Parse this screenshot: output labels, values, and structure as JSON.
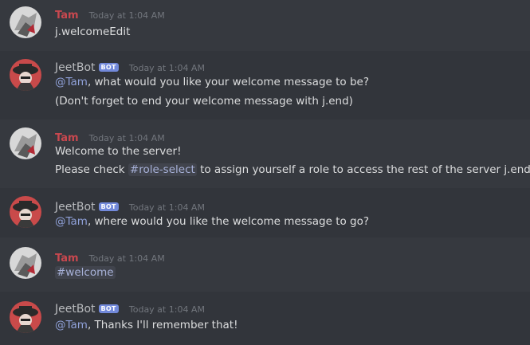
{
  "messages": [
    {
      "author": "Tam",
      "timestamp": "Today at 1:04 AM",
      "lines": [
        "j.welcomeEdit"
      ]
    },
    {
      "author": "JeetBot",
      "badge": "BOT",
      "timestamp": "Today at 1:04 AM",
      "mention": "@Tam",
      "line1_rest": ", what would you like your welcome message to be?",
      "line2": "(Don't forget to end your welcome message with j.end)"
    },
    {
      "author": "Tam",
      "timestamp": "Today at 1:04 AM",
      "line1": "Welcome to the server!",
      "line2_pre": "Please check ",
      "channel": "#role-select",
      "line2_post": " to assign yourself a role to access the rest of the server j.end"
    },
    {
      "author": "JeetBot",
      "badge": "BOT",
      "timestamp": "Today at 1:04 AM",
      "mention": "@Tam",
      "line1_rest": ", where would you like the welcome message to go?"
    },
    {
      "author": "Tam",
      "timestamp": "Today at 1:04 AM",
      "channel": "#welcome"
    },
    {
      "author": "JeetBot",
      "badge": "BOT",
      "timestamp": "Today at 1:04 AM",
      "mention": "@Tam",
      "line1_rest": ", Thanks I'll remember that!"
    }
  ],
  "colors": {
    "background": "#36393f",
    "tam_name": "#c9484f",
    "bot_badge": "#7289da",
    "mention": "#8fa0d8"
  },
  "icons": {
    "tam_avatar": "grey-robot-avatar",
    "bot_avatar": "red-hat-avatar"
  }
}
